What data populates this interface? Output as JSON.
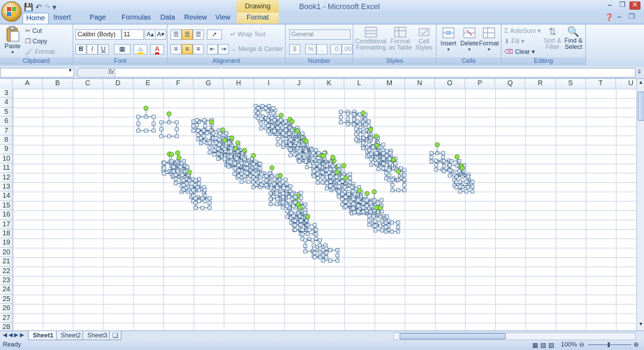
{
  "window": {
    "title": "Book1 - Microsoft Excel",
    "context_tool": "Drawing Tools"
  },
  "tabs": [
    "Home",
    "Insert",
    "Page Layout",
    "Formulas",
    "Data",
    "Review",
    "View",
    "Format"
  ],
  "clipboard": {
    "paste": "Paste",
    "cut": "Cut",
    "copy": "Copy",
    "format_painter": "Format Painter",
    "label": "Clipboard"
  },
  "font": {
    "name": "Calibri (Body)",
    "size": "11",
    "bold": "B",
    "italic": "I",
    "underline": "U",
    "label": "Font"
  },
  "alignment": {
    "wrap_text": "Wrap Text",
    "merge_center": "Merge & Center",
    "label": "Alignment"
  },
  "number": {
    "format": "General",
    "currency": "$",
    "percent": "%",
    "label": "Number"
  },
  "styles": {
    "conditional_formatting": "Conditional Formatting",
    "format_as_table": "Format as Table",
    "cell_styles": "Cell Styles",
    "label": "Styles"
  },
  "cells": {
    "insert": "Insert",
    "delete": "Delete",
    "format": "Format",
    "label": "Cells"
  },
  "editing": {
    "autosum": "AutoSum",
    "fill": "Fill",
    "clear": "Clear",
    "sort_filter": "Sort & Filter",
    "find_select": "Find & Select",
    "label": "Editing"
  },
  "formula_bar": {
    "fx": "fx",
    "name_box": "",
    "content": ""
  },
  "columns": [
    "A",
    "B",
    "C",
    "D",
    "E",
    "F",
    "G",
    "H",
    "I",
    "J",
    "K",
    "L",
    "M",
    "N",
    "O",
    "P",
    "Q",
    "R",
    "S",
    "T",
    "U"
  ],
  "rows": [
    "3",
    "4",
    "5",
    "6",
    "7",
    "8",
    "9",
    "10",
    "11",
    "12",
    "13",
    "14",
    "15",
    "16",
    "17",
    "18",
    "19",
    "20",
    "21",
    "22",
    "23",
    "24",
    "25",
    "26",
    "27",
    "28"
  ],
  "sheets": [
    "Sheet1",
    "Sheet2",
    "Sheet3"
  ],
  "status": {
    "ready": "Ready",
    "zoom": "100%"
  },
  "colors": {
    "shape_outline": "#3c5e86",
    "handle_fill": "#8fe04f",
    "handle_stroke": "#3f7f1a"
  }
}
